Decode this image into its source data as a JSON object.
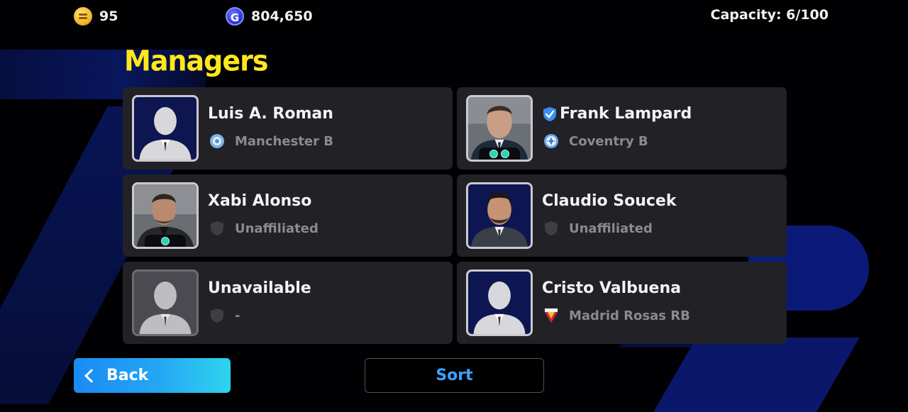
{
  "topbar": {
    "coins": "95",
    "gp": "804,650",
    "gp_icon_letter": "G",
    "capacity": "Capacity: 6/100"
  },
  "title": "Managers",
  "managers": [
    {
      "name": "Luis A. Roman",
      "club": "Manchester B",
      "club_icon": "manchester-b-crest-icon",
      "portrait": "silhouette-blue",
      "verified": false,
      "badges": 0
    },
    {
      "name": "Frank Lampard",
      "club": "Coventry B",
      "club_icon": "coventry-b-crest-icon",
      "portrait": "photo",
      "verified": true,
      "badges": 2
    },
    {
      "name": "Xabi Alonso",
      "club": "Unaffiliated",
      "club_icon": "shield-icon",
      "portrait": "photo",
      "verified": false,
      "badges": 1
    },
    {
      "name": "Claudio Soucek",
      "club": "Unaffiliated",
      "club_icon": "shield-icon",
      "portrait": "photo",
      "verified": false,
      "badges": 0
    },
    {
      "name": "Unavailable",
      "club": "-",
      "club_icon": "shield-icon",
      "portrait": "silhouette-grey",
      "verified": false,
      "badges": 0
    },
    {
      "name": "Cristo Valbuena",
      "club": "Madrid Rosas RB",
      "club_icon": "madrid-rosas-crest-icon",
      "portrait": "silhouette-blue",
      "verified": false,
      "badges": 0
    }
  ],
  "buttons": {
    "back": "Back",
    "sort": "Sort"
  },
  "colors": {
    "title": "#ffe81a",
    "card_bg": "#222226",
    "back_gradient_start": "#1a8af5",
    "back_gradient_end": "#2fd4ee",
    "sort_text": "#3aa2ff"
  }
}
